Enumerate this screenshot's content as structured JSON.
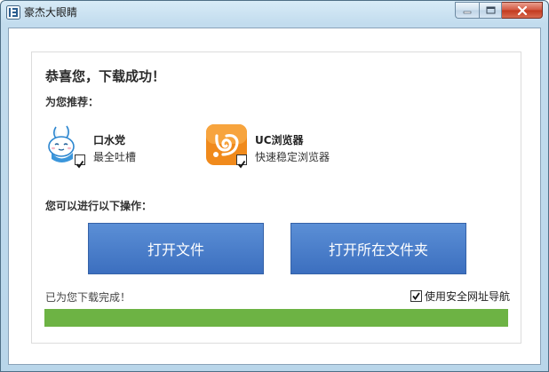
{
  "window": {
    "title": "豪杰大眼睛"
  },
  "dialog": {
    "headline": "恭喜您，下载成功！",
    "recommend_label": "为您推荐：",
    "recommendations": [
      {
        "name": "口水党",
        "desc": "最全吐槽",
        "checked": true,
        "icon": "rabbit-mascot-icon"
      },
      {
        "name": "UC浏览器",
        "desc": "快速稳定浏览器",
        "checked": true,
        "icon": "uc-browser-icon"
      }
    ],
    "ops_label": "您可以进行以下操作：",
    "buttons": {
      "open_file": "打开文件",
      "open_folder": "打开所在文件夹"
    },
    "status_text": "已为您下载完成！",
    "safe_nav": {
      "label": "使用安全网址导航",
      "checked": true
    },
    "progress": 1.0
  },
  "colors": {
    "button_blue": "#4a7fcd",
    "progress_green": "#6db344",
    "uc_orange": "#f08a1c"
  }
}
